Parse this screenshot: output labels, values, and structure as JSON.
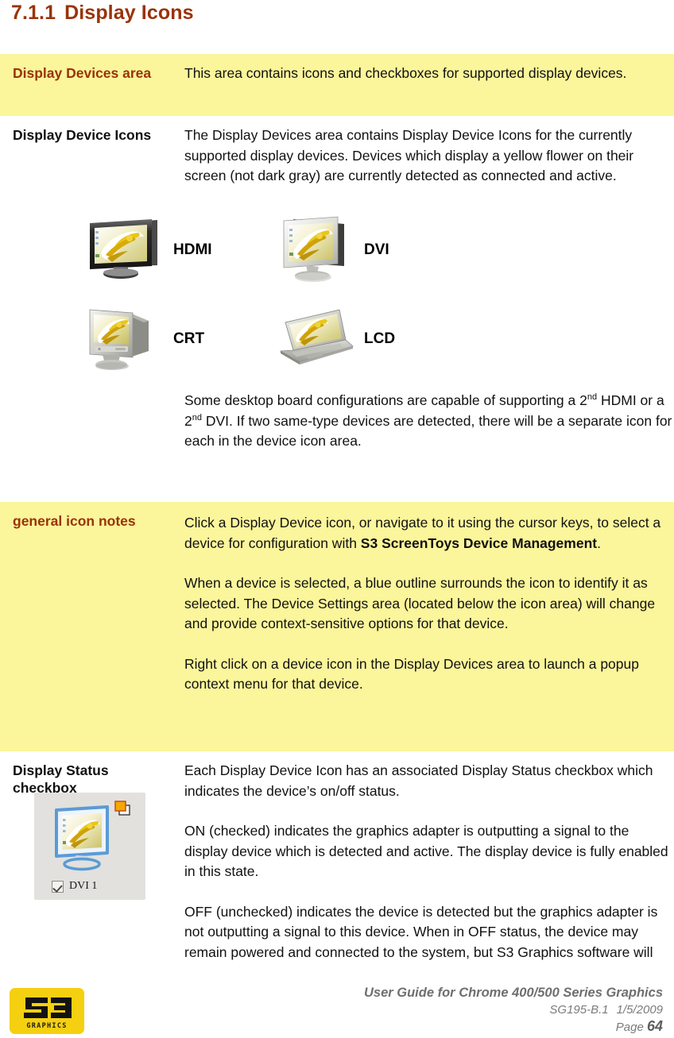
{
  "heading": {
    "number": "7.1.1",
    "title": "Display Icons"
  },
  "rows": [
    {
      "label": "Display Devices area",
      "paragraphs": [
        "This area contains icons and checkboxes for supported display devices."
      ]
    },
    {
      "label": "Display Device Icons",
      "paragraphs": [
        "The Display Devices area contains Display Device Icons for the currently supported display devices. Devices which display a yellow flower on their screen (not dark gray) are currently detected as connected and active.",
        "Some desktop board configurations are capable of supporting a 2nd HDMI or a 2nd DVI. If two same-type devices are detected, there will be a separate icon for each in the device icon area."
      ]
    },
    {
      "label": "general icon notes",
      "paragraphs": [
        "Click a Display Device icon, or navigate to it using the cursor keys, to select a device for configuration with S3 ScreenToys Device Management.",
        "When a device is selected, a blue outline surrounds the icon to identify it as selected. The Device Settings area (located below the icon area) will change and provide context-sensitive options for that device.",
        "Right click on a device icon in the Display Devices area to launch a popup context menu for that device."
      ]
    },
    {
      "label": "Display Status checkbox",
      "paragraphs": [
        "Each Display Device Icon has an associated Display Status checkbox which indicates the device’s on/off status.",
        "ON (checked) indicates the graphics adapter is outputting a signal to the display device which is detected and active. The display device is fully enabled in this state.",
        "OFF (unchecked) indicates the device is detected but the graphics adapter is not outputting a signal to this device. When in OFF status, the device may remain powered and connected to the system, but S3 Graphics software will"
      ]
    }
  ],
  "device_icons": [
    {
      "name": "hdmi-display-icon",
      "caption": "HDMI"
    },
    {
      "name": "dvi-display-icon",
      "caption": "DVI"
    },
    {
      "name": "crt-display-icon",
      "caption": "CRT"
    },
    {
      "name": "lcd-display-icon",
      "caption": "LCD"
    }
  ],
  "status_sample": {
    "checkbox_label": "DVI 1",
    "checked": true
  },
  "footer": {
    "logo_primary": "S3",
    "logo_secondary": "GRAPHICS",
    "guide_title": "User Guide for Chrome 400/500 Series Graphics",
    "doc_id": "SG195-B.1",
    "doc_date": "1/5/2009",
    "page_label": "Page",
    "page_number": "64"
  },
  "colors": {
    "heading": "#9A3309",
    "shaded_row": "#FBF59B",
    "accent_label": "#9A3309",
    "logo_yellow": "#F5D010",
    "footer_text": "#7b7b7b",
    "selection_outline": "#5B9BD5"
  }
}
